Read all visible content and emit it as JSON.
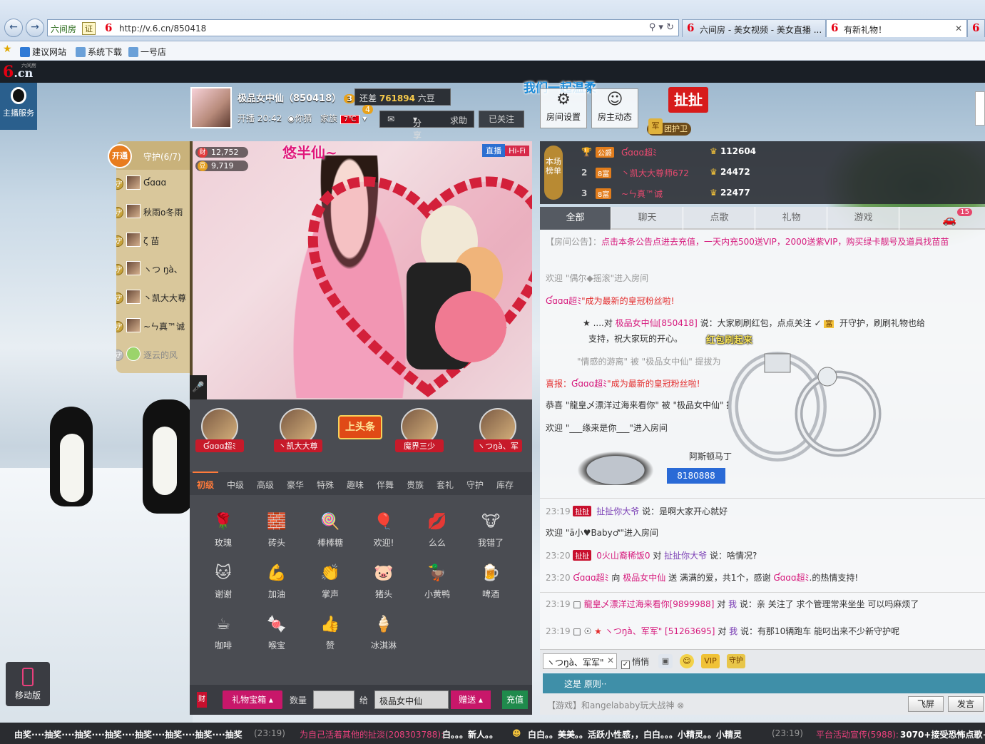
{
  "browser": {
    "address": {
      "site_label": "六间房",
      "badge": "证",
      "url": "http://v.6.cn/850418"
    },
    "tabs": [
      {
        "label": "六间房 - 美女视频 - 美女直播 ..."
      },
      {
        "label": "有新礼物！"
      }
    ],
    "bookmarks": [
      "建议网站",
      "系统下载",
      "一号店"
    ]
  },
  "site": {
    "logo": "6.cn",
    "logo_small": "六间房",
    "service_label": "主播服务"
  },
  "anchor": {
    "name": "极品女中仙（850418）",
    "level": "3",
    "gap_prefix": "还差",
    "gap_value": "761894",
    "gap_suffix": "六豆",
    "next_level": "4",
    "start_time": "开播 20:42",
    "location": "你猜",
    "family_label": "家族",
    "family_tag": "7℃",
    "share": "分享",
    "help": "求助",
    "follow": "已关注",
    "slogan": "我们一起温柔"
  },
  "room_buttons": [
    {
      "label": "房间设置",
      "icon": "gear-icon"
    },
    {
      "label": "房主动态",
      "icon": "user-icon"
    }
  ],
  "guard_club": {
    "chache": "扯扯",
    "badge": "团护卫",
    "badge_icon": "军"
  },
  "guards": {
    "open_label": "开通",
    "title": "守护(6/7)",
    "items": [
      {
        "name": "Ɠɑɑɑ",
        "online": true
      },
      {
        "name": "秋雨o冬雨",
        "online": true
      },
      {
        "name": "ζ 苗",
        "online": true
      },
      {
        "name": "ヽつ ŋà、",
        "online": true
      },
      {
        "name": "丶凯大大尊",
        "online": true
      },
      {
        "name": "~ㄣ真™诚",
        "online": true
      },
      {
        "name": "逐云的风",
        "online": false
      }
    ]
  },
  "video": {
    "title": "悠半仙~",
    "fortune": "12,752",
    "beans": "9,719",
    "tag_live": "直播",
    "tag_quality": "Hi-Fi"
  },
  "fans": [
    {
      "name": "Ɠɑɑɑ超ﾐ"
    },
    {
      "name": "丶凯大大尊"
    },
    {
      "name": "魔界三少"
    },
    {
      "name": "ヽつŋà、军"
    }
  ],
  "headline_label": "上头条",
  "gift_tabs": [
    "初级",
    "中级",
    "高级",
    "豪华",
    "特殊",
    "趣味",
    "伴舞",
    "贵族",
    "套礼",
    "守护",
    "库存"
  ],
  "gifts": [
    {
      "name": "玫瑰",
      "icon": "🌹"
    },
    {
      "name": "砖头",
      "icon": "🧱"
    },
    {
      "name": "棒棒糖",
      "icon": "🍭"
    },
    {
      "name": "欢迎!",
      "icon": "🎈"
    },
    {
      "name": "么么",
      "icon": "💋"
    },
    {
      "name": "我错了",
      "icon": "🐮"
    },
    {
      "name": "谢谢",
      "icon": "🐱"
    },
    {
      "name": "加油",
      "icon": "💪"
    },
    {
      "name": "掌声",
      "icon": "👏"
    },
    {
      "name": "猪头",
      "icon": "🐷"
    },
    {
      "name": "小黄鸭",
      "icon": "🦆"
    },
    {
      "name": "啤酒",
      "icon": "🍺"
    },
    {
      "name": "咖啡",
      "icon": "☕"
    },
    {
      "name": "喉宝",
      "icon": "🍬"
    },
    {
      "name": "赞",
      "icon": "👍"
    },
    {
      "name": "冰淇淋",
      "icon": "🍦"
    }
  ],
  "gift_bar": {
    "fortune": "财",
    "box": "礼物宝箱",
    "qty": "数量",
    "to": "给",
    "to_value": "极品女中仙",
    "send": "赠送",
    "recharge": "充值"
  },
  "mobile": {
    "label": "移动版"
  },
  "rank": {
    "label": "本场榜单",
    "rows": [
      {
        "no": "1",
        "badge": "公爵",
        "name": "Ɠɑɑɑ超ﾐ",
        "value": "112604"
      },
      {
        "no": "2",
        "badge": "8富",
        "name": "丶凯大大尊师672",
        "value": "24472"
      },
      {
        "no": "3",
        "badge": "8富",
        "name": "~ㄣ真™诚",
        "value": "22477"
      }
    ]
  },
  "chat_tabs": [
    "全部",
    "聊天",
    "点歌",
    "礼物",
    "游戏"
  ],
  "car_count": "15",
  "chat": {
    "notice_label": "【房间公告】：",
    "notice_text": "点击本条公告点进去充值，一天内充500送VIP，2000送紫VIP，购买绿卡靓号及道具找苗苗",
    "m1": "欢迎 \"偶尔◆摇滚\"进入房间",
    "m2_name": "Ɠɑɑɑ超ﾐ",
    "m2_text": "\"成为最新的皇冠粉丝啦!",
    "m3_to": "极品女中仙[850418]",
    "m3_text": "说：大家刷刷红包，点点关注",
    "m3_tail": "开守护，刷刷礼物也给",
    "m3_line2": "支持，祝大家玩的开心。",
    "red_packet": "红包刷起来",
    "m4": "\"情感的游离\" 被 \"极品女中仙\" 提拔为",
    "m5_label": "喜报：",
    "m5_name": "Ɠɑɑɑ超ﾐ",
    "m5_text": "\"成为最新的皇冠粉丝啦!",
    "m6": "恭喜 \"龍皇乄漂洋过海来看你\" 被 \"极品女中仙\" 提",
    "m7": "欢迎 \"___缘来是你___\"进入房间",
    "car_name": "阿斯顿马丁",
    "car_number": "8180888",
    "c1_time": "23:19",
    "c1_badge": "扯扯",
    "c1_name": "扯扯你大爷",
    "c1_text": "说：是啊大家开心就好",
    "m8": "欢迎 \"ā小♥Baby♂\"进入房间",
    "c2_time": "23:20",
    "c2_badge": "扯扯",
    "c2_name": "0火山裔稀饭0",
    "c2_to": "扯扯你大爷",
    "c2_text": "说：啥情况?",
    "c3_time": "23:20",
    "c3_name": "Ɠɑɑɑ超ﾐ",
    "c3_mid": "向",
    "c3_to": "极品女中仙",
    "c3_text": "送 满满的爱，共1个，感谢",
    "c3_tail": ".的热情支持!",
    "c4_time": "23:19",
    "c4_name": "龍皇乄漂洋过海来看你[9899988]",
    "c4_mid": "对",
    "c4_to": "我",
    "c4_text": "说：亲 关注了 求个管理常来坐坐 可以吗",
    "c4_tail": "麻烦了",
    "c5_time": "23:19",
    "c5_name": "ヽつŋà、军军\" [51263695]",
    "c5_mid": "对",
    "c5_to": "我",
    "c5_text": "说：有那10辆跑车 能叼出来不少新守护呢"
  },
  "chat_input": {
    "target": "ヽつŋà、军军\"",
    "whisper": "悄悄",
    "message": "这是 原则··",
    "vip": "VIP",
    "guard": "守护"
  },
  "chat_bottom": {
    "game_ad": "【游戏】和angelababy玩大战神",
    "fly": "飞屏",
    "say": "发言"
  },
  "ticker": {
    "t1": "由奖····抽奖····抽奖····抽奖····抽奖····抽奖····抽奖····抽奖",
    "t1_time": "(23:19)",
    "t2": "为自己活着其他的扯淡(208303788):",
    "t2_text": "白。。。新人。。",
    "t3": "白白。。美美。。活跃小性感，，白白。。。小精灵。。小精灵",
    "t3_time": "(23:19)",
    "t4": "平台活动宣传(5988):",
    "t4_text": "3070+接受恐怖点歌+"
  }
}
